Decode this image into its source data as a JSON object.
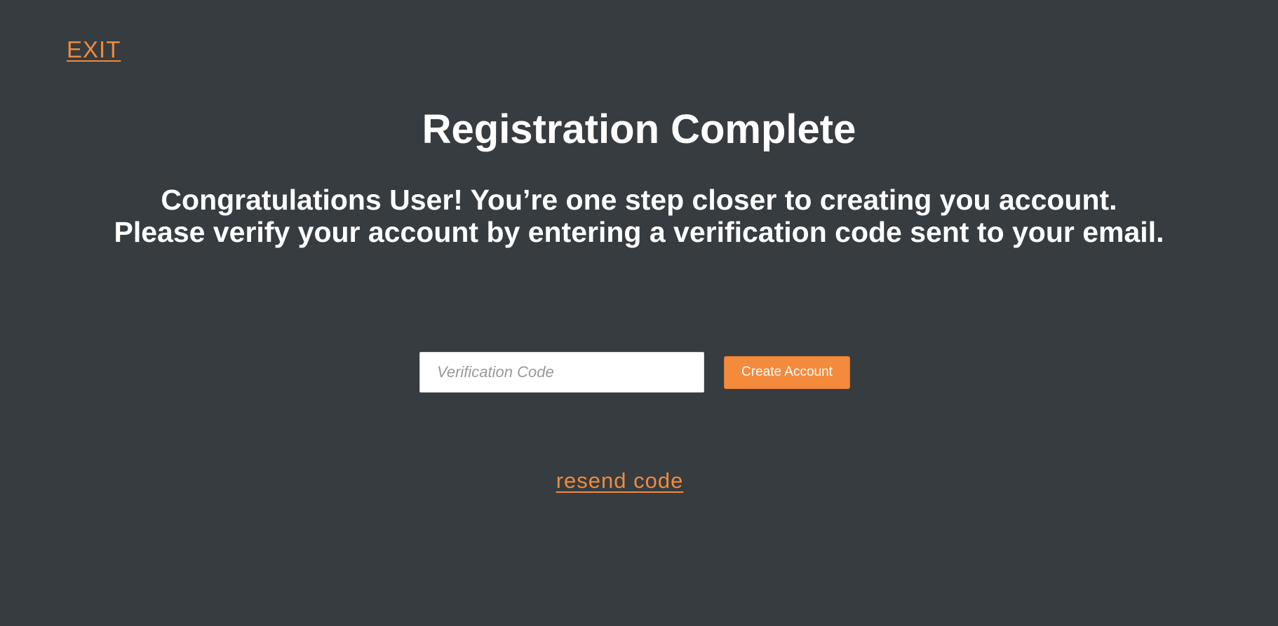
{
  "nav": {
    "exit_label": "EXIT"
  },
  "main": {
    "title": "Registration Complete",
    "message_line1": "Congratulations User! You’re one step closer to creating you account.",
    "message_line2": "Please verify your account by entering a verification code sent to your email."
  },
  "form": {
    "code_placeholder": "Verification Code",
    "code_value": "",
    "submit_label": "Create Account",
    "resend_label": "resend code"
  },
  "colors": {
    "background": "#363c3f",
    "accent": "#f48a3c",
    "text": "#ffffff"
  }
}
